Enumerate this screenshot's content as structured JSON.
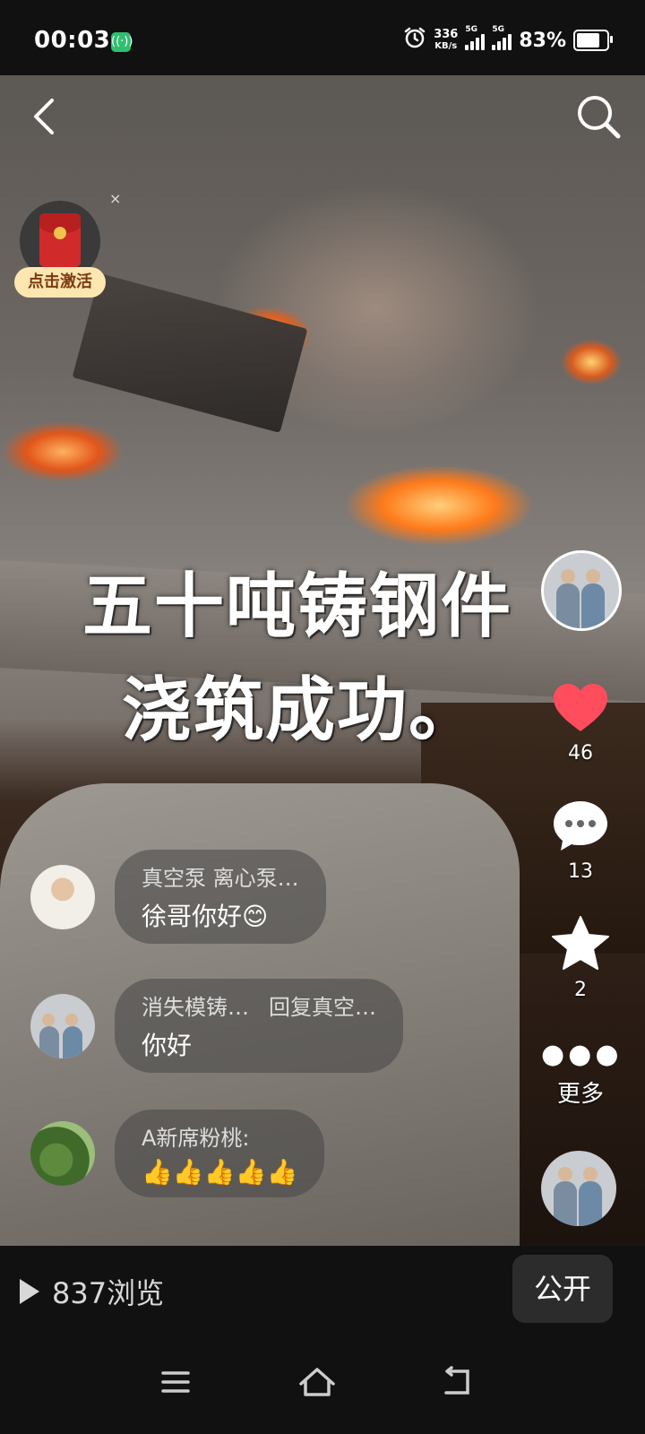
{
  "status_bar": {
    "time": "00:03",
    "net_speed_value": "336",
    "net_speed_unit": "KB/s",
    "signal1_tag": "5G",
    "signal2_tag": "5G",
    "battery_text": "83%",
    "battery_level": 0.83
  },
  "video": {
    "caption_line1": "五十吨铸钢件",
    "caption_line2": "浇筑成功。"
  },
  "red_packet": {
    "label": "点击激活",
    "close": "×"
  },
  "rail": {
    "likes": "46",
    "comments": "13",
    "favorites": "2",
    "more_label": "更多",
    "like_color": "#ff4d5e"
  },
  "comments": [
    {
      "meta_a": "真空泵 离心泵…",
      "meta_b": "",
      "text": "徐哥你好😊"
    },
    {
      "meta_a": "消失模铸…",
      "meta_b": "回复真空…",
      "text": "你好"
    },
    {
      "meta_a": "A新席粉桃:",
      "meta_b": "",
      "text": "👍👍👍👍👍"
    }
  ],
  "bottom": {
    "views": "837浏览",
    "public_button": "公开"
  }
}
